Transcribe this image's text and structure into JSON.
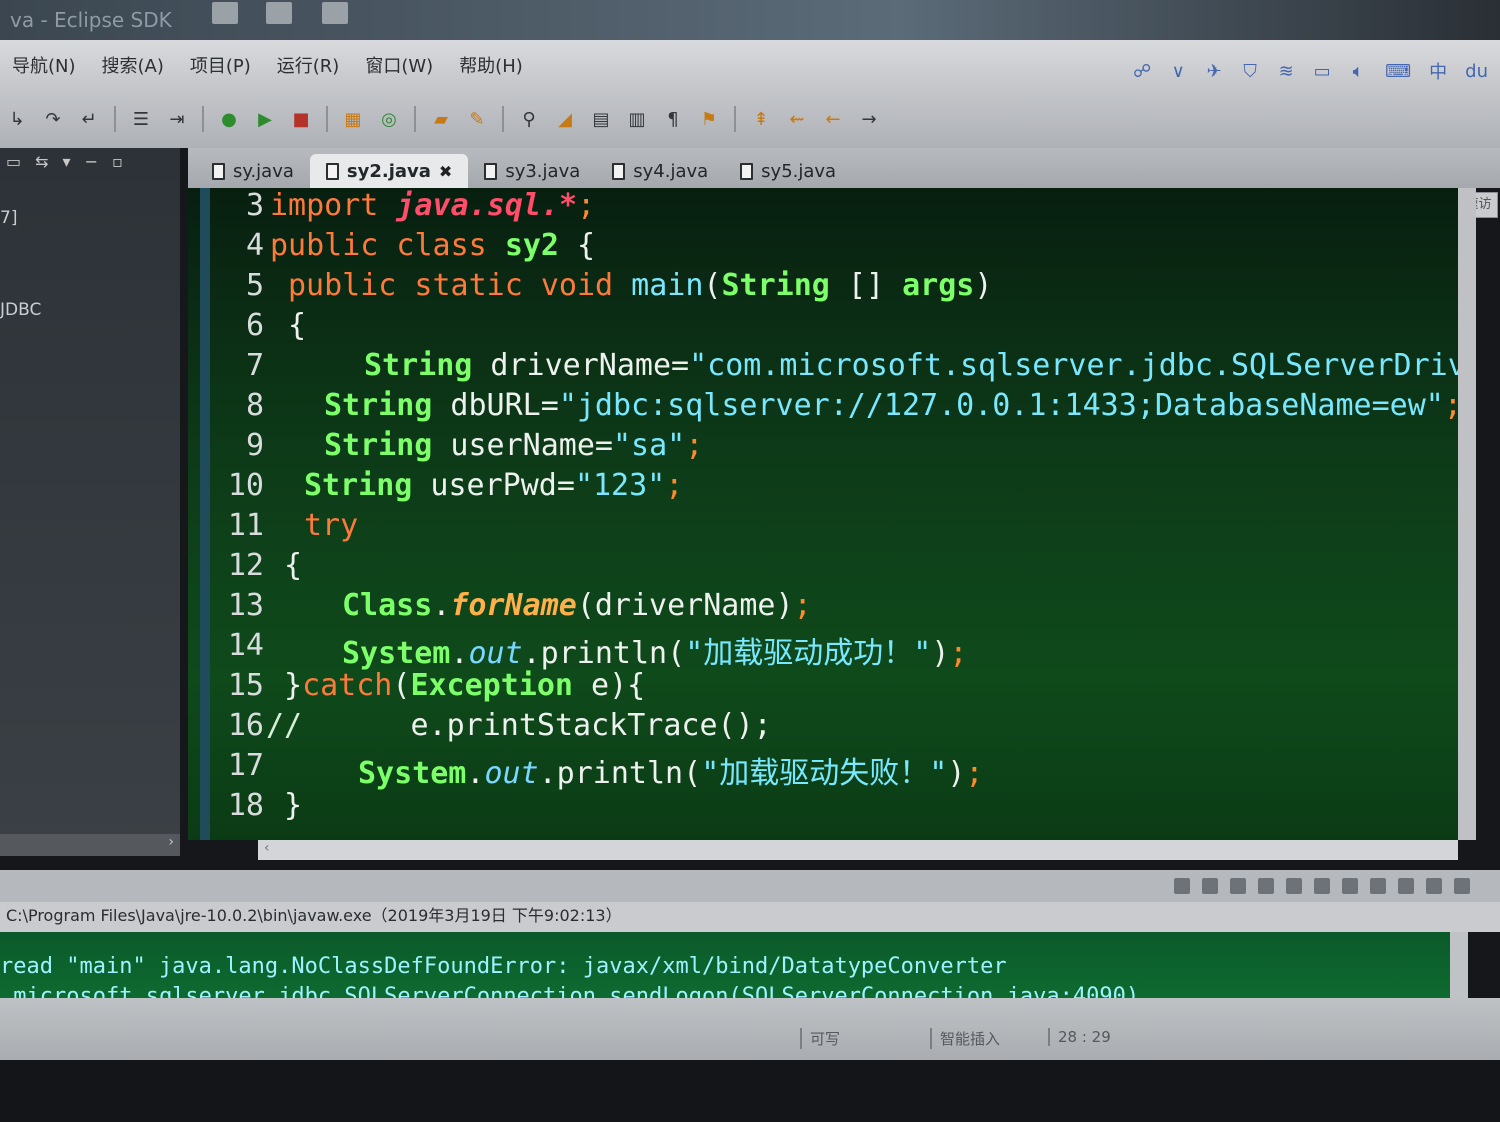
{
  "window": {
    "title": "va - Eclipse SDK"
  },
  "menubar": {
    "items": [
      "导航(N)",
      "搜索(A)",
      "项目(P)",
      "运行(R)",
      "窗口(W)",
      "帮助(H)"
    ]
  },
  "tray": {
    "ime_label": "中",
    "du_label": "du"
  },
  "left_panel": {
    "line1": "7]",
    "line2": "JDBC"
  },
  "editor": {
    "tabs": [
      {
        "label": "sy.java"
      },
      {
        "label": "sy2.java"
      },
      {
        "label": "sy3.java"
      },
      {
        "label": "sy4.java"
      },
      {
        "label": "sy5.java"
      }
    ],
    "quick_access": "快速访",
    "line_numbers": [
      "3",
      "4",
      "5",
      "6",
      "7",
      "8",
      "9",
      "10",
      "11",
      "12",
      "13",
      "14",
      "15",
      "16",
      "17",
      "18"
    ],
    "code": {
      "l3": {
        "kw": "import ",
        "pkg": "java.sql.*",
        "semi": ";"
      },
      "l4": {
        "kw": "public class ",
        "name": "sy2",
        "rest": " {"
      },
      "l5": {
        "kw": "public static void ",
        "method": "main",
        "open": "(",
        "type": "String",
        "mid": " [] ",
        "arg": "args",
        "close": ")"
      },
      "l6": {
        "text": "{"
      },
      "l7": {
        "type": "String",
        "rest": " driverName=",
        "str": "\"com.microsoft.sqlserver.jdbc.SQLServerDriver\"",
        "semi": ";"
      },
      "l8": {
        "type": "String",
        "rest": " dbURL=",
        "str": "\"jdbc:sqlserver://127.0.0.1:1433;DatabaseName=ew\"",
        "semi": ";"
      },
      "l9": {
        "type": "String",
        "rest": " userName=",
        "str": "\"sa\"",
        "semi": ";"
      },
      "l10": {
        "type": "String",
        "rest": " userPwd=",
        "str": "\"123\"",
        "semi": ";"
      },
      "l11": {
        "kw": "try"
      },
      "l12": {
        "text": "{"
      },
      "l13": {
        "type": "Class",
        "dot": ".",
        "method": "forName",
        "rest": "(driverName)",
        "semi": ";"
      },
      "l14": {
        "type": "System",
        "dot": ".",
        "field": "out",
        "rest": ".println(",
        "str": "\"加载驱动成功！\"",
        "close": ")",
        "semi": ";"
      },
      "l15": {
        "open": "}",
        "kw": "catch",
        "p1": "(",
        "type": "Exception",
        "rest": " e){"
      },
      "l16": {
        "comment": "//",
        "rest": "      e.printStackTrace();"
      },
      "l17": {
        "type": "System",
        "dot": ".",
        "field": "out",
        "rest": ".println(",
        "str": "\"加载驱动失败！\"",
        "close": ")",
        "semi": ";"
      },
      "l18": {
        "text": "}"
      }
    }
  },
  "console": {
    "header": "C:\\Program Files\\Java\\jre-10.0.2\\bin\\javaw.exe（2019年3月19日 下午9:02:13）",
    "lines": [
      "read \"main\" java.lang.NoClassDefFoundError: javax/xml/bind/DatatypeConverter",
      " microsoft.sqlserver.jdbc.SQLServerConnection.sendLogon(SQLServerConnection.java:4090)"
    ]
  },
  "statusbar": {
    "writable": "可写",
    "insert_mode": "智能插入",
    "position": "28 : 29"
  }
}
